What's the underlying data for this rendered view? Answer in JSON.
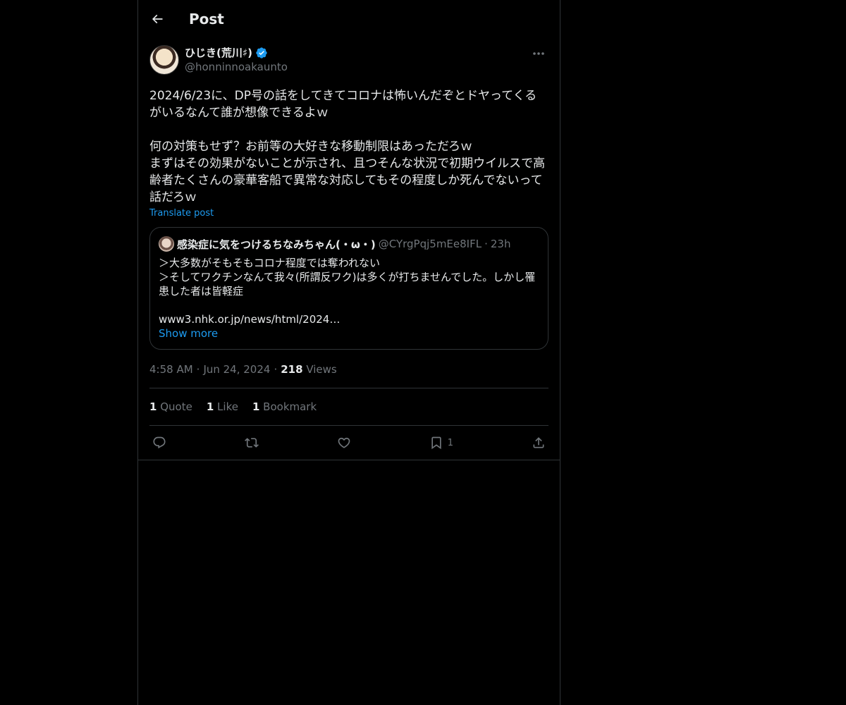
{
  "header": {
    "title": "Post"
  },
  "post": {
    "author_name": "ひじき(荒川♯)",
    "author_handle": "@honninnoakaunto",
    "text": "2024/6/23に、DP号の話をしてきてコロナは怖いんだぞとドヤってくるがいるなんて誰が想像できるよｗ\n\n何の対策もせず？お前等の大好きな移動制限はあっただろｗ\nまずはその効果がないことが示され、且つそんな状況で初期ウイルスで高齢者たくさんの豪華客船で異常な対応してもその程度しか死んでないって話だろｗ",
    "translate_label": "Translate post",
    "time": "4:58 AM",
    "date": "Jun 24, 2024",
    "views_count": "218",
    "views_label": "Views"
  },
  "quote": {
    "author_name": "感染症に気をつけるちなみちゃん(・ω・)",
    "author_handle": "@CYrgPqj5mEe8IFL",
    "time": "23h",
    "text": "＞大多数がそもそもコロナ程度では奪われない\n＞そしてワクチンなんて我々(所謂反ワク)は多くが打ちませんでした。しかし罹患した者は皆軽症\n\nwww3.nhk.or.jp/news/html/2024…",
    "show_more_label": "Show more"
  },
  "stats": {
    "quotes_count": "1",
    "quotes_label": "Quote",
    "likes_count": "1",
    "likes_label": "Like",
    "bookmarks_count": "1",
    "bookmarks_label": "Bookmark"
  },
  "actions": {
    "bookmark_count": "1"
  },
  "icons": {
    "back": "arrow-left-icon",
    "more": "more-horizontal-icon",
    "verified": "verified-badge-icon",
    "reply": "reply-icon",
    "repost": "repost-icon",
    "like": "heart-icon",
    "bookmark": "bookmark-icon",
    "share": "share-icon"
  },
  "colors": {
    "background": "#000000",
    "text": "#e7e9ea",
    "secondary_text": "#71767b",
    "accent": "#1d9bf0",
    "border": "#2f3336"
  }
}
